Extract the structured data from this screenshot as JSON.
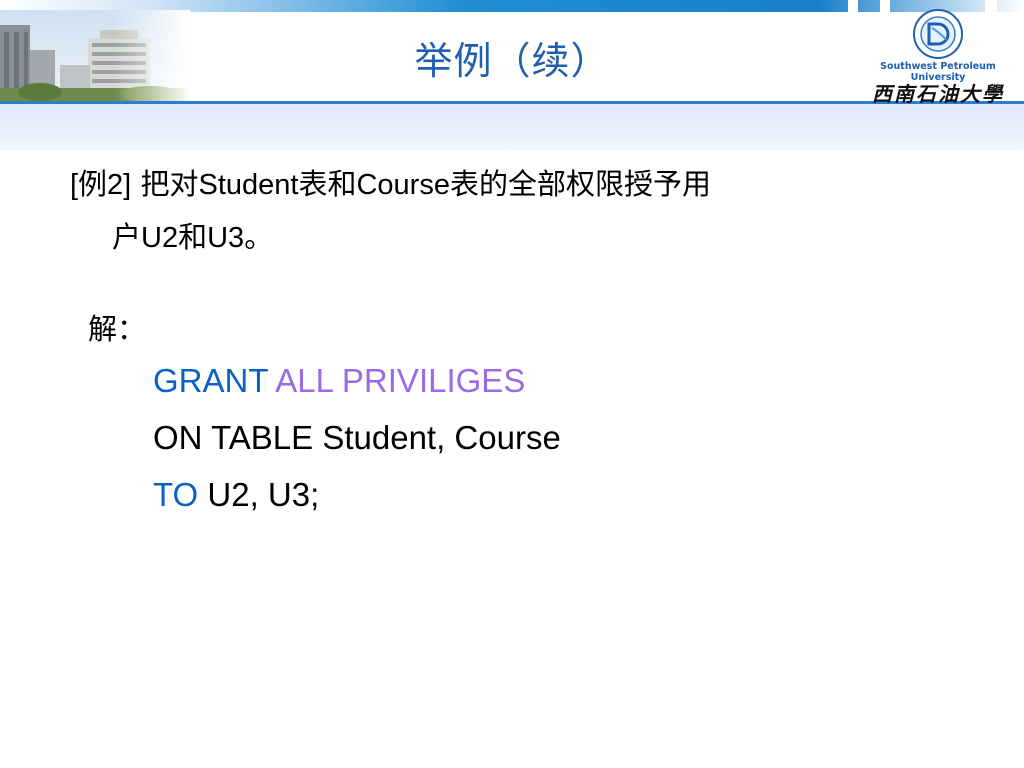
{
  "header": {
    "title": "举例（续）",
    "logo": {
      "english_name": "Southwest Petroleum University",
      "chinese_name": "西南石油大學",
      "emblem": "university-emblem"
    },
    "photo": "campus-buildings"
  },
  "example": {
    "prefix": "[例2]",
    "text_a": "把对",
    "word_student": "Student",
    "text_b": "表和",
    "word_course": "Course",
    "text_c": "表的全部权限授予用",
    "text_d": "户",
    "u2": "U2",
    "text_e": "和",
    "u3": "U3",
    "text_f": "。"
  },
  "solution": {
    "label": "解：",
    "line1_kw": "GRANT",
    "line1_priv": "ALL PRIVILIGES",
    "line2": "ON TABLE Student, Course",
    "line3_kw": "TO",
    "line3_rest": "U2, U3;"
  },
  "colors": {
    "keyword": "#0b62c4",
    "privilege": "#9a6ae8",
    "title": "#1f5fb0"
  }
}
